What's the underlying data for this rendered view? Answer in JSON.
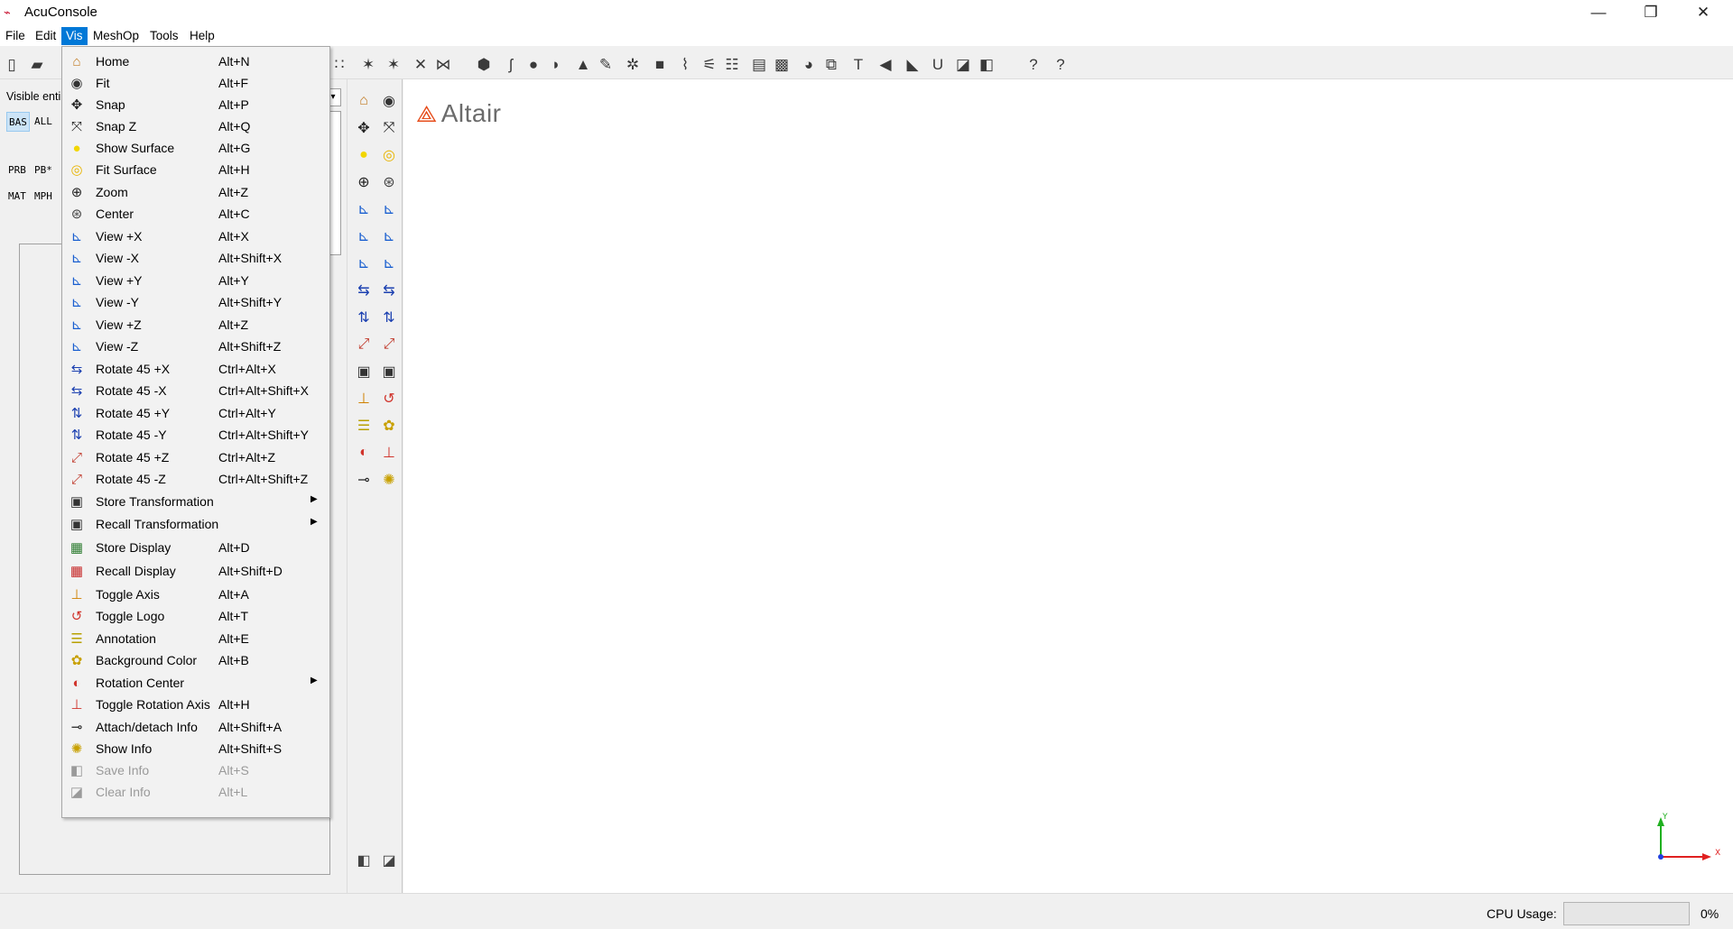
{
  "window": {
    "title": "AcuConsole",
    "minimize_glyph": "—",
    "restore_glyph": "❐",
    "close_glyph": "✕"
  },
  "menubar": [
    "File",
    "Edit",
    "Vis",
    "MeshOp",
    "Tools",
    "Help"
  ],
  "active_menu": "Vis",
  "left_panel": {
    "visible_entities_label": "Visible enti",
    "buttons_row1": [
      "BAS",
      "ALL"
    ],
    "buttons_row2": [
      "PRB",
      "PB*"
    ],
    "buttons_row3": [
      "MAT",
      "MPH"
    ],
    "combo_arrow": "▾"
  },
  "viewport": {
    "logo_text": "Altair",
    "axis_labels": {
      "y": "Y",
      "x": "X"
    }
  },
  "statusbar": {
    "cpu_label": "CPU Usage:",
    "cpu_value": "0%",
    "cpu_fraction": 0
  },
  "vis_menu": [
    {
      "label": "Home",
      "accel": "Alt+N",
      "icon": "home-icon",
      "glyph": "⌂",
      "color": "#c0781e"
    },
    {
      "label": "Fit",
      "accel": "Alt+F",
      "icon": "eye-icon",
      "glyph": "◉",
      "color": "#333333"
    },
    {
      "label": "Snap",
      "accel": "Alt+P",
      "icon": "move-arrows-icon",
      "glyph": "✥",
      "color": "#222222"
    },
    {
      "label": "Snap Z",
      "accel": "Alt+Q",
      "icon": "expand-arrows-icon",
      "glyph": "⤧",
      "color": "#222222"
    },
    {
      "label": "Show Surface",
      "accel": "Alt+G",
      "icon": "yellow-circle-icon",
      "glyph": "●",
      "color": "#f2d600"
    },
    {
      "label": "Fit Surface",
      "accel": "Alt+H",
      "icon": "fit-surface-icon",
      "glyph": "◎",
      "color": "#e8b400"
    },
    {
      "label": "Zoom",
      "accel": "Alt+Z",
      "icon": "zoom-icon",
      "glyph": "⊕",
      "color": "#222222"
    },
    {
      "label": "Center",
      "accel": "Alt+C",
      "icon": "crosshair-icon",
      "glyph": "⊛",
      "color": "#444444"
    },
    {
      "label": "View +X",
      "accel": "Alt+X",
      "icon": "view-pos-x-icon",
      "glyph": "⊾",
      "color": "#1a5fd0"
    },
    {
      "label": "View -X",
      "accel": "Alt+Shift+X",
      "icon": "view-neg-x-icon",
      "glyph": "⊾",
      "color": "#1a5fd0"
    },
    {
      "label": "View +Y",
      "accel": "Alt+Y",
      "icon": "view-pos-y-icon",
      "glyph": "⊾",
      "color": "#1a5fd0"
    },
    {
      "label": "View -Y",
      "accel": "Alt+Shift+Y",
      "icon": "view-neg-y-icon",
      "glyph": "⊾",
      "color": "#1a5fd0"
    },
    {
      "label": "View +Z",
      "accel": "Alt+Z",
      "icon": "view-pos-z-icon",
      "glyph": "⊾",
      "color": "#1a5fd0"
    },
    {
      "label": "View -Z",
      "accel": "Alt+Shift+Z",
      "icon": "view-neg-z-icon",
      "glyph": "⊾",
      "color": "#1a5fd0"
    },
    {
      "label": "Rotate 45 +X",
      "accel": "Ctrl+Alt+X",
      "icon": "rotate-pos-x-icon",
      "glyph": "⇆",
      "color": "#1a3fb0"
    },
    {
      "label": "Rotate 45 -X",
      "accel": "Ctrl+Alt+Shift+X",
      "icon": "rotate-neg-x-icon",
      "glyph": "⇆",
      "color": "#1a3fb0"
    },
    {
      "label": "Rotate 45 +Y",
      "accel": "Ctrl+Alt+Y",
      "icon": "rotate-pos-y-icon",
      "glyph": "⇅",
      "color": "#1a3fb0"
    },
    {
      "label": "Rotate 45 -Y",
      "accel": "Ctrl+Alt+Shift+Y",
      "icon": "rotate-neg-y-icon",
      "glyph": "⇅",
      "color": "#1a3fb0"
    },
    {
      "label": "Rotate 45 +Z",
      "accel": "Ctrl+Alt+Z",
      "icon": "rotate-pos-z-icon",
      "glyph": "⤢",
      "color": "#c0392b"
    },
    {
      "label": "Rotate 45 -Z",
      "accel": "Ctrl+Alt+Shift+Z",
      "icon": "rotate-neg-z-icon",
      "glyph": "⤢",
      "color": "#c0392b"
    },
    {
      "label": "Store Transformation",
      "accel": "",
      "icon": "camera-store-icon",
      "glyph": "▣",
      "color": "#333333",
      "submenu": true
    },
    {
      "label": "Recall Transformation",
      "accel": "",
      "icon": "camera-recall-icon",
      "glyph": "▣",
      "color": "#333333",
      "submenu": true
    },
    {
      "label": "Store Display",
      "accel": "Alt+D",
      "icon": "store-display-icon",
      "glyph": "▦",
      "color": "#2e7d32"
    },
    {
      "label": "Recall Display",
      "accel": "Alt+Shift+D",
      "icon": "recall-display-icon",
      "glyph": "▦",
      "color": "#c62828"
    },
    {
      "label": "Toggle Axis",
      "accel": "Alt+A",
      "icon": "axis-icon",
      "glyph": "⊥",
      "color": "#d08000"
    },
    {
      "label": "Toggle Logo",
      "accel": "Alt+T",
      "icon": "logo-icon",
      "glyph": "↺",
      "color": "#d0342c"
    },
    {
      "label": "Annotation",
      "accel": "Alt+E",
      "icon": "annotation-icon",
      "glyph": "☰",
      "color": "#b8a000"
    },
    {
      "label": "Background Color",
      "accel": "Alt+B",
      "icon": "palette-icon",
      "glyph": "✿",
      "color": "#c8a000"
    },
    {
      "label": "Rotation Center",
      "accel": "",
      "icon": "rotation-center-icon",
      "glyph": "◐",
      "color": "#d0342c",
      "submenu": true
    },
    {
      "label": "Toggle Rotation Axis",
      "accel": "Alt+H",
      "icon": "rotation-axis-icon",
      "glyph": "⊥",
      "color": "#d0342c"
    },
    {
      "label": "Attach/detach Info",
      "accel": "Alt+Shift+A",
      "icon": "pin-icon",
      "glyph": "⊸",
      "color": "#222222"
    },
    {
      "label": "Show Info",
      "accel": "Alt+Shift+S",
      "icon": "lightbulb-icon",
      "glyph": "✺",
      "color": "#c8a000"
    },
    {
      "label": "Save Info",
      "accel": "Alt+S",
      "icon": "save-info-icon",
      "glyph": "◧",
      "color": "#9a9a9a",
      "disabled": true
    },
    {
      "label": "Clear Info",
      "accel": "Alt+L",
      "icon": "eraser-icon",
      "glyph": "◪",
      "color": "#9a9a9a",
      "disabled": true
    }
  ],
  "submenu_arrow": "▶",
  "toolbar_icons": [
    {
      "name": "new-file-icon",
      "glyph": "▯"
    },
    {
      "name": "open-folder-icon",
      "glyph": "▰"
    },
    {
      "name": "handle-icon",
      "glyph": "∷"
    },
    {
      "name": "mesh-tool-a-icon",
      "glyph": "✶"
    },
    {
      "name": "mesh-tool-b-icon",
      "glyph": "✶"
    },
    {
      "name": "mesh-tool-c-icon",
      "glyph": "✕"
    },
    {
      "name": "mesh-tool-d-icon",
      "glyph": "⋈"
    },
    {
      "name": "geometry-import-icon",
      "glyph": "⬢"
    },
    {
      "name": "curve-icon",
      "glyph": "ʃ"
    },
    {
      "name": "sphere-icon",
      "glyph": "●"
    },
    {
      "name": "surface-icon",
      "glyph": "◗"
    },
    {
      "name": "cone-icon",
      "glyph": "▲"
    },
    {
      "name": "pencil-icon",
      "glyph": "✎"
    },
    {
      "name": "gear-mesh-icon",
      "glyph": "✲"
    },
    {
      "name": "solid-box-icon",
      "glyph": "■"
    },
    {
      "name": "plot-icon",
      "glyph": "⌇"
    },
    {
      "name": "flow-icon",
      "glyph": "⚟"
    },
    {
      "name": "list-icon",
      "glyph": "☷"
    },
    {
      "name": "color-map-icon",
      "glyph": "▤"
    },
    {
      "name": "image-icon",
      "glyph": "▩"
    },
    {
      "name": "pie-icon",
      "glyph": "◕"
    },
    {
      "name": "window-icon",
      "glyph": "⧉"
    },
    {
      "name": "text-icon",
      "glyph": "T"
    },
    {
      "name": "audio-icon",
      "glyph": "◀"
    },
    {
      "name": "arrow-shape-icon",
      "glyph": "◣"
    },
    {
      "name": "udf-icon",
      "glyph": "U"
    },
    {
      "name": "layers-a-icon",
      "glyph": "◪"
    },
    {
      "name": "layers-b-icon",
      "glyph": "◧"
    },
    {
      "name": "help-doc-icon",
      "glyph": "?"
    },
    {
      "name": "whats-this-icon",
      "glyph": "?"
    }
  ],
  "vtoolbar_icons": [
    {
      "name": "home-icon",
      "glyph": "⌂",
      "color": "#c0781e"
    },
    {
      "name": "eye-icon",
      "glyph": "◉",
      "color": "#333333"
    },
    {
      "name": "move-arrows-icon",
      "glyph": "✥",
      "color": "#222222"
    },
    {
      "name": "expand-arrows-icon",
      "glyph": "⤧",
      "color": "#222222"
    },
    {
      "name": "yellow-circle-icon",
      "glyph": "●",
      "color": "#f2d600"
    },
    {
      "name": "fit-surface-icon",
      "glyph": "◎",
      "color": "#e8b400"
    },
    {
      "name": "zoom-icon",
      "glyph": "⊕",
      "color": "#222222"
    },
    {
      "name": "crosshair-icon",
      "glyph": "⊛",
      "color": "#444444"
    },
    {
      "name": "view-pos-x-icon",
      "glyph": "⊾",
      "color": "#1a5fd0"
    },
    {
      "name": "view-neg-x-icon",
      "glyph": "⊾",
      "color": "#1a5fd0"
    },
    {
      "name": "view-pos-y-icon",
      "glyph": "⊾",
      "color": "#1a5fd0"
    },
    {
      "name": "view-neg-y-icon",
      "glyph": "⊾",
      "color": "#1a5fd0"
    },
    {
      "name": "view-pos-z-icon",
      "glyph": "⊾",
      "color": "#1a5fd0"
    },
    {
      "name": "view-neg-z-icon",
      "glyph": "⊾",
      "color": "#1a5fd0"
    },
    {
      "name": "rotate-pos-x-icon",
      "glyph": "⇆",
      "color": "#1a3fb0"
    },
    {
      "name": "rotate-neg-x-icon",
      "glyph": "⇆",
      "color": "#1a3fb0"
    },
    {
      "name": "rotate-pos-y-icon",
      "glyph": "⇅",
      "color": "#1a3fb0"
    },
    {
      "name": "rotate-neg-y-icon",
      "glyph": "⇅",
      "color": "#1a3fb0"
    },
    {
      "name": "rotate-pos-z-icon",
      "glyph": "⤢",
      "color": "#c0392b"
    },
    {
      "name": "rotate-neg-z-icon",
      "glyph": "⤢",
      "color": "#c0392b"
    },
    {
      "name": "camera-store-icon",
      "glyph": "▣",
      "color": "#333333"
    },
    {
      "name": "camera-recall-icon",
      "glyph": "▣",
      "color": "#333333"
    },
    {
      "name": "axis-icon",
      "glyph": "⊥",
      "color": "#d08000"
    },
    {
      "name": "logo-icon",
      "glyph": "↺",
      "color": "#d0342c"
    },
    {
      "name": "annotation-icon",
      "glyph": "☰",
      "color": "#b8a000"
    },
    {
      "name": "palette-icon",
      "glyph": "✿",
      "color": "#c8a000"
    },
    {
      "name": "rotation-center-icon",
      "glyph": "◐",
      "color": "#d0342c"
    },
    {
      "name": "rotation-axis-icon",
      "glyph": "⊥",
      "color": "#d0342c"
    },
    {
      "name": "pin-icon",
      "glyph": "⊸",
      "color": "#222222"
    },
    {
      "name": "lightbulb-icon",
      "glyph": "✺",
      "color": "#c8a000"
    },
    {
      "name": "save-info-icon",
      "glyph": "◧",
      "color": "#444444"
    },
    {
      "name": "eraser-icon",
      "glyph": "◪",
      "color": "#444444"
    }
  ]
}
